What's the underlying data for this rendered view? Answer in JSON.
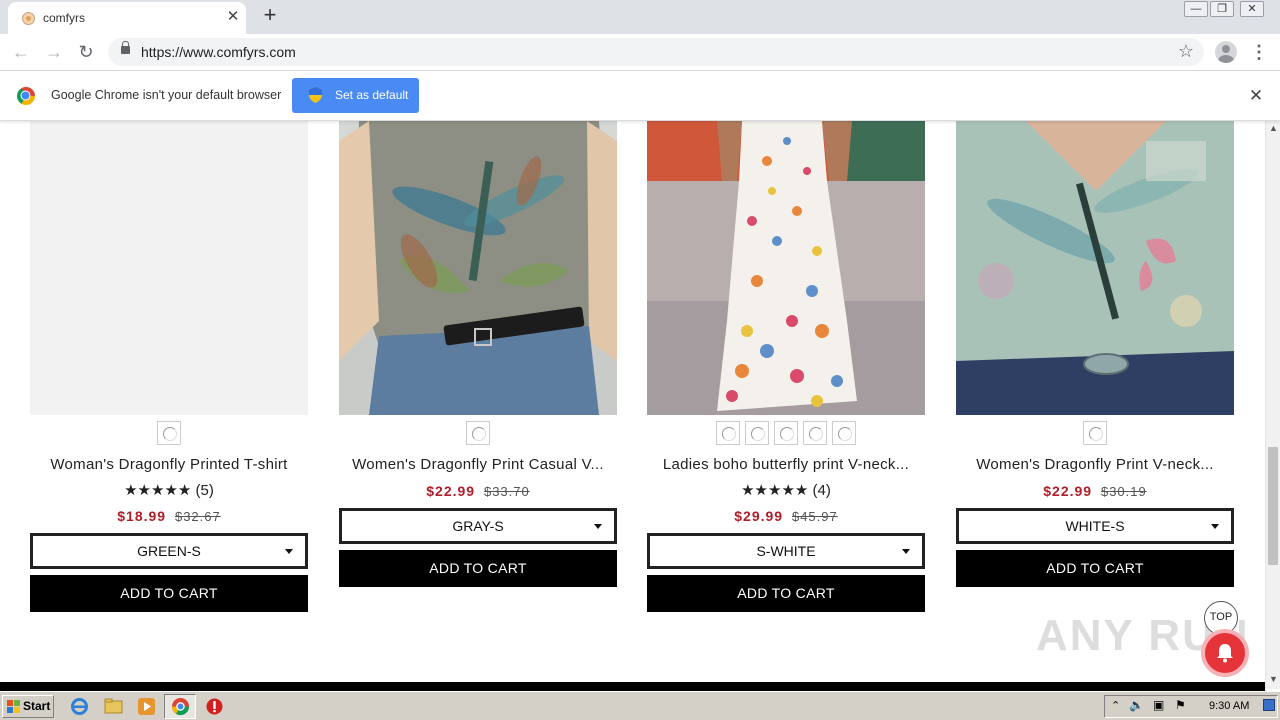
{
  "browser": {
    "tab_title": "comfyrs",
    "url": "https://www.comfyrs.com",
    "infobar_message": "Google Chrome isn't your default browser",
    "set_default_label": "Set as default"
  },
  "products": [
    {
      "name": "Woman's Dragonfly Printed T-shirt",
      "stars": "★★★★★",
      "review_count": "(5)",
      "sale_price": "$18.99",
      "original_price": "$32.67",
      "selected_option": "GREEN-S",
      "add_to_cart": "ADD TO CART",
      "swatch_count": 1
    },
    {
      "name": "Women's Dragonfly Print Casual V...",
      "sale_price": "$22.99",
      "original_price": "$33.70",
      "selected_option": "GRAY-S",
      "add_to_cart": "ADD TO CART",
      "swatch_count": 1
    },
    {
      "name": "Ladies boho butterfly print V-neck...",
      "stars": "★★★★★",
      "review_count": "(4)",
      "sale_price": "$29.99",
      "original_price": "$45.97",
      "selected_option": "S-WHITE",
      "add_to_cart": "ADD TO CART",
      "swatch_count": 5
    },
    {
      "name": "Women's Dragonfly Print V-neck...",
      "sale_price": "$22.99",
      "original_price": "$30.19",
      "selected_option": "WHITE-S",
      "add_to_cart": "ADD TO CART",
      "swatch_count": 1
    }
  ],
  "page": {
    "top_label": "TOP",
    "watermark": "ANY RUN"
  },
  "taskbar": {
    "start_label": "Start",
    "clock": "9:30 AM"
  },
  "colors": {
    "sale_price": "#b01e2a",
    "button_black": "#000000",
    "chrome_blue": "#4a8af4",
    "notification_red": "#e5333a"
  }
}
